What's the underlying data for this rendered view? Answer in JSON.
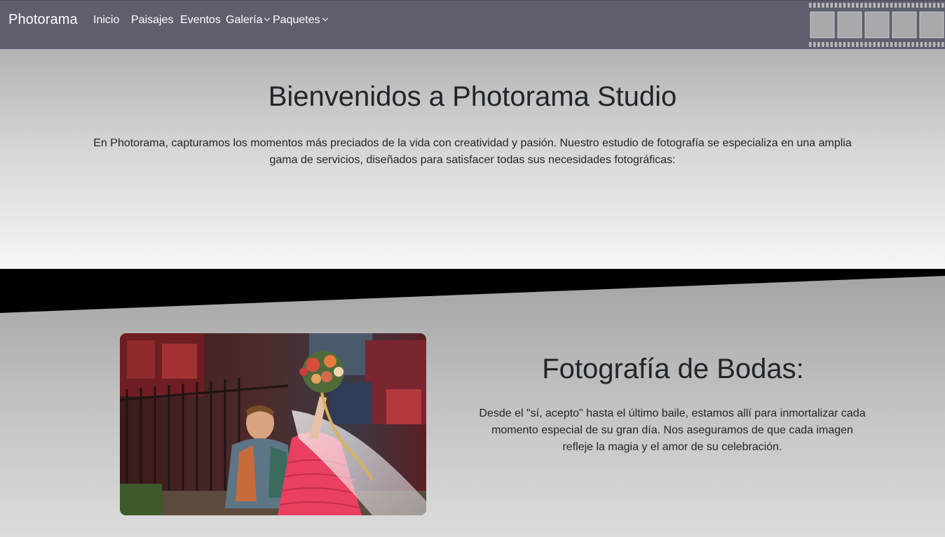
{
  "navbar": {
    "brand": "Photorama",
    "links": {
      "inicio": "Inicio",
      "paisajes": "Paisajes",
      "eventos": "Eventos",
      "galeria": "Galería",
      "paquetes": "Paquetes"
    },
    "background": "#5e5f6c"
  },
  "hero": {
    "title": "Bienvenidos a Photorama Studio",
    "text": "En Photorama, capturamos los momentos más preciados de la vida con creatividad y pasión. Nuestro estudio de fotografía se especializa en una amplia gama de servicios, diseñados para satisfacer todas sus necesidades fotográficas:"
  },
  "weddings": {
    "title": "Fotografía de Bodas:",
    "text": "Desde el \"sí, acepto\" hasta el último baile, estamos allí para inmortalizar cada momento especial de su gran día. Nos aseguramos de que cada imagen refleje la magia y el amor de su celebración.",
    "image_icon": "wedding-photo"
  },
  "colors": {
    "accent_dress": "#e8405e",
    "divider": "#000000"
  }
}
